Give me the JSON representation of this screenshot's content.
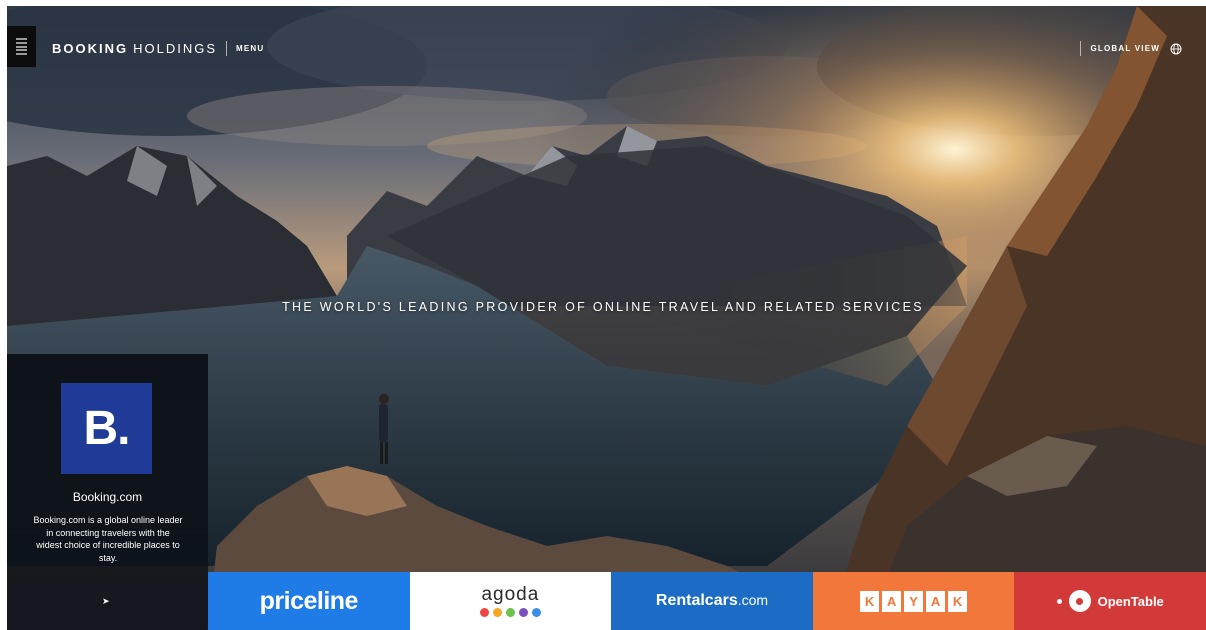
{
  "header": {
    "brand_bold": "BOOKING",
    "brand_light": "HOLDINGS",
    "menu_label": "MENU",
    "global_view_label": "GLOBAL VIEW",
    "menu_icon": "hamburger-icon",
    "globe_icon": "globe-icon"
  },
  "hero": {
    "tagline": "THE WORLD'S LEADING PROVIDER OF ONLINE TRAVEL AND RELATED SERVICES"
  },
  "featured": {
    "logo_text": "B.",
    "name": "Booking.com",
    "description": "Booking.com is a global online leader in connecting travelers with the widest choice of incredible places to stay.",
    "next_icon": "arrow-right-icon",
    "arrow": "➤"
  },
  "brands": {
    "priceline": "priceline",
    "agoda": "agoda",
    "rentalcars_main": "Rentalcars",
    "rentalcars_suffix": ".com",
    "kayak_letters": [
      "K",
      "A",
      "Y",
      "A",
      "K"
    ],
    "opentable": "OpenTable"
  },
  "colors": {
    "booking_blue": "#1f3b97",
    "priceline_blue": "#1f7be6",
    "rentalcars_blue": "#1c6cc6",
    "kayak_orange": "#f1773a",
    "opentable_red": "#d23a3a",
    "agoda_dots": [
      "#ef4444",
      "#f5a623",
      "#6cc24a",
      "#7b4fbd",
      "#3a8ee6"
    ]
  }
}
